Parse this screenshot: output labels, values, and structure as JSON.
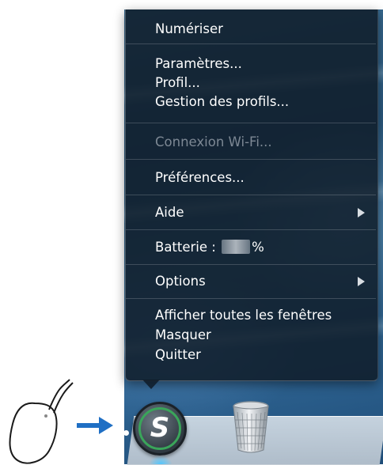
{
  "menu": {
    "items": [
      {
        "label": "Numériser",
        "enabled": true
      },
      {
        "label": "Paramètres...",
        "enabled": true
      },
      {
        "label": "Profil...",
        "enabled": true
      },
      {
        "label": "Gestion des profils...",
        "enabled": true
      },
      {
        "label": "Connexion Wi-Fi...",
        "enabled": false
      },
      {
        "label": "Préférences...",
        "enabled": true
      },
      {
        "label": "Aide",
        "enabled": true,
        "submenu": true
      },
      {
        "label": "Batterie :",
        "enabled": true
      },
      {
        "label": "Options",
        "enabled": true,
        "submenu": true
      },
      {
        "label": "Afficher toutes les fenêtres",
        "enabled": true
      },
      {
        "label": "Masquer",
        "enabled": true
      },
      {
        "label": "Quitter",
        "enabled": true
      }
    ],
    "battery_unit": "%"
  },
  "dock": {
    "app_icon": "scansnap-manager-icon",
    "trash_icon": "trash-icon"
  },
  "illustration": {
    "mouse_icon": "mouse-icon",
    "arrow_icon": "arrow-right-icon",
    "arrow_color": "#1f6fc4"
  },
  "colors": {
    "menu_bg": "#0e1a26",
    "menu_text": "#ffffff",
    "menu_text_disabled": "#7d8894"
  }
}
